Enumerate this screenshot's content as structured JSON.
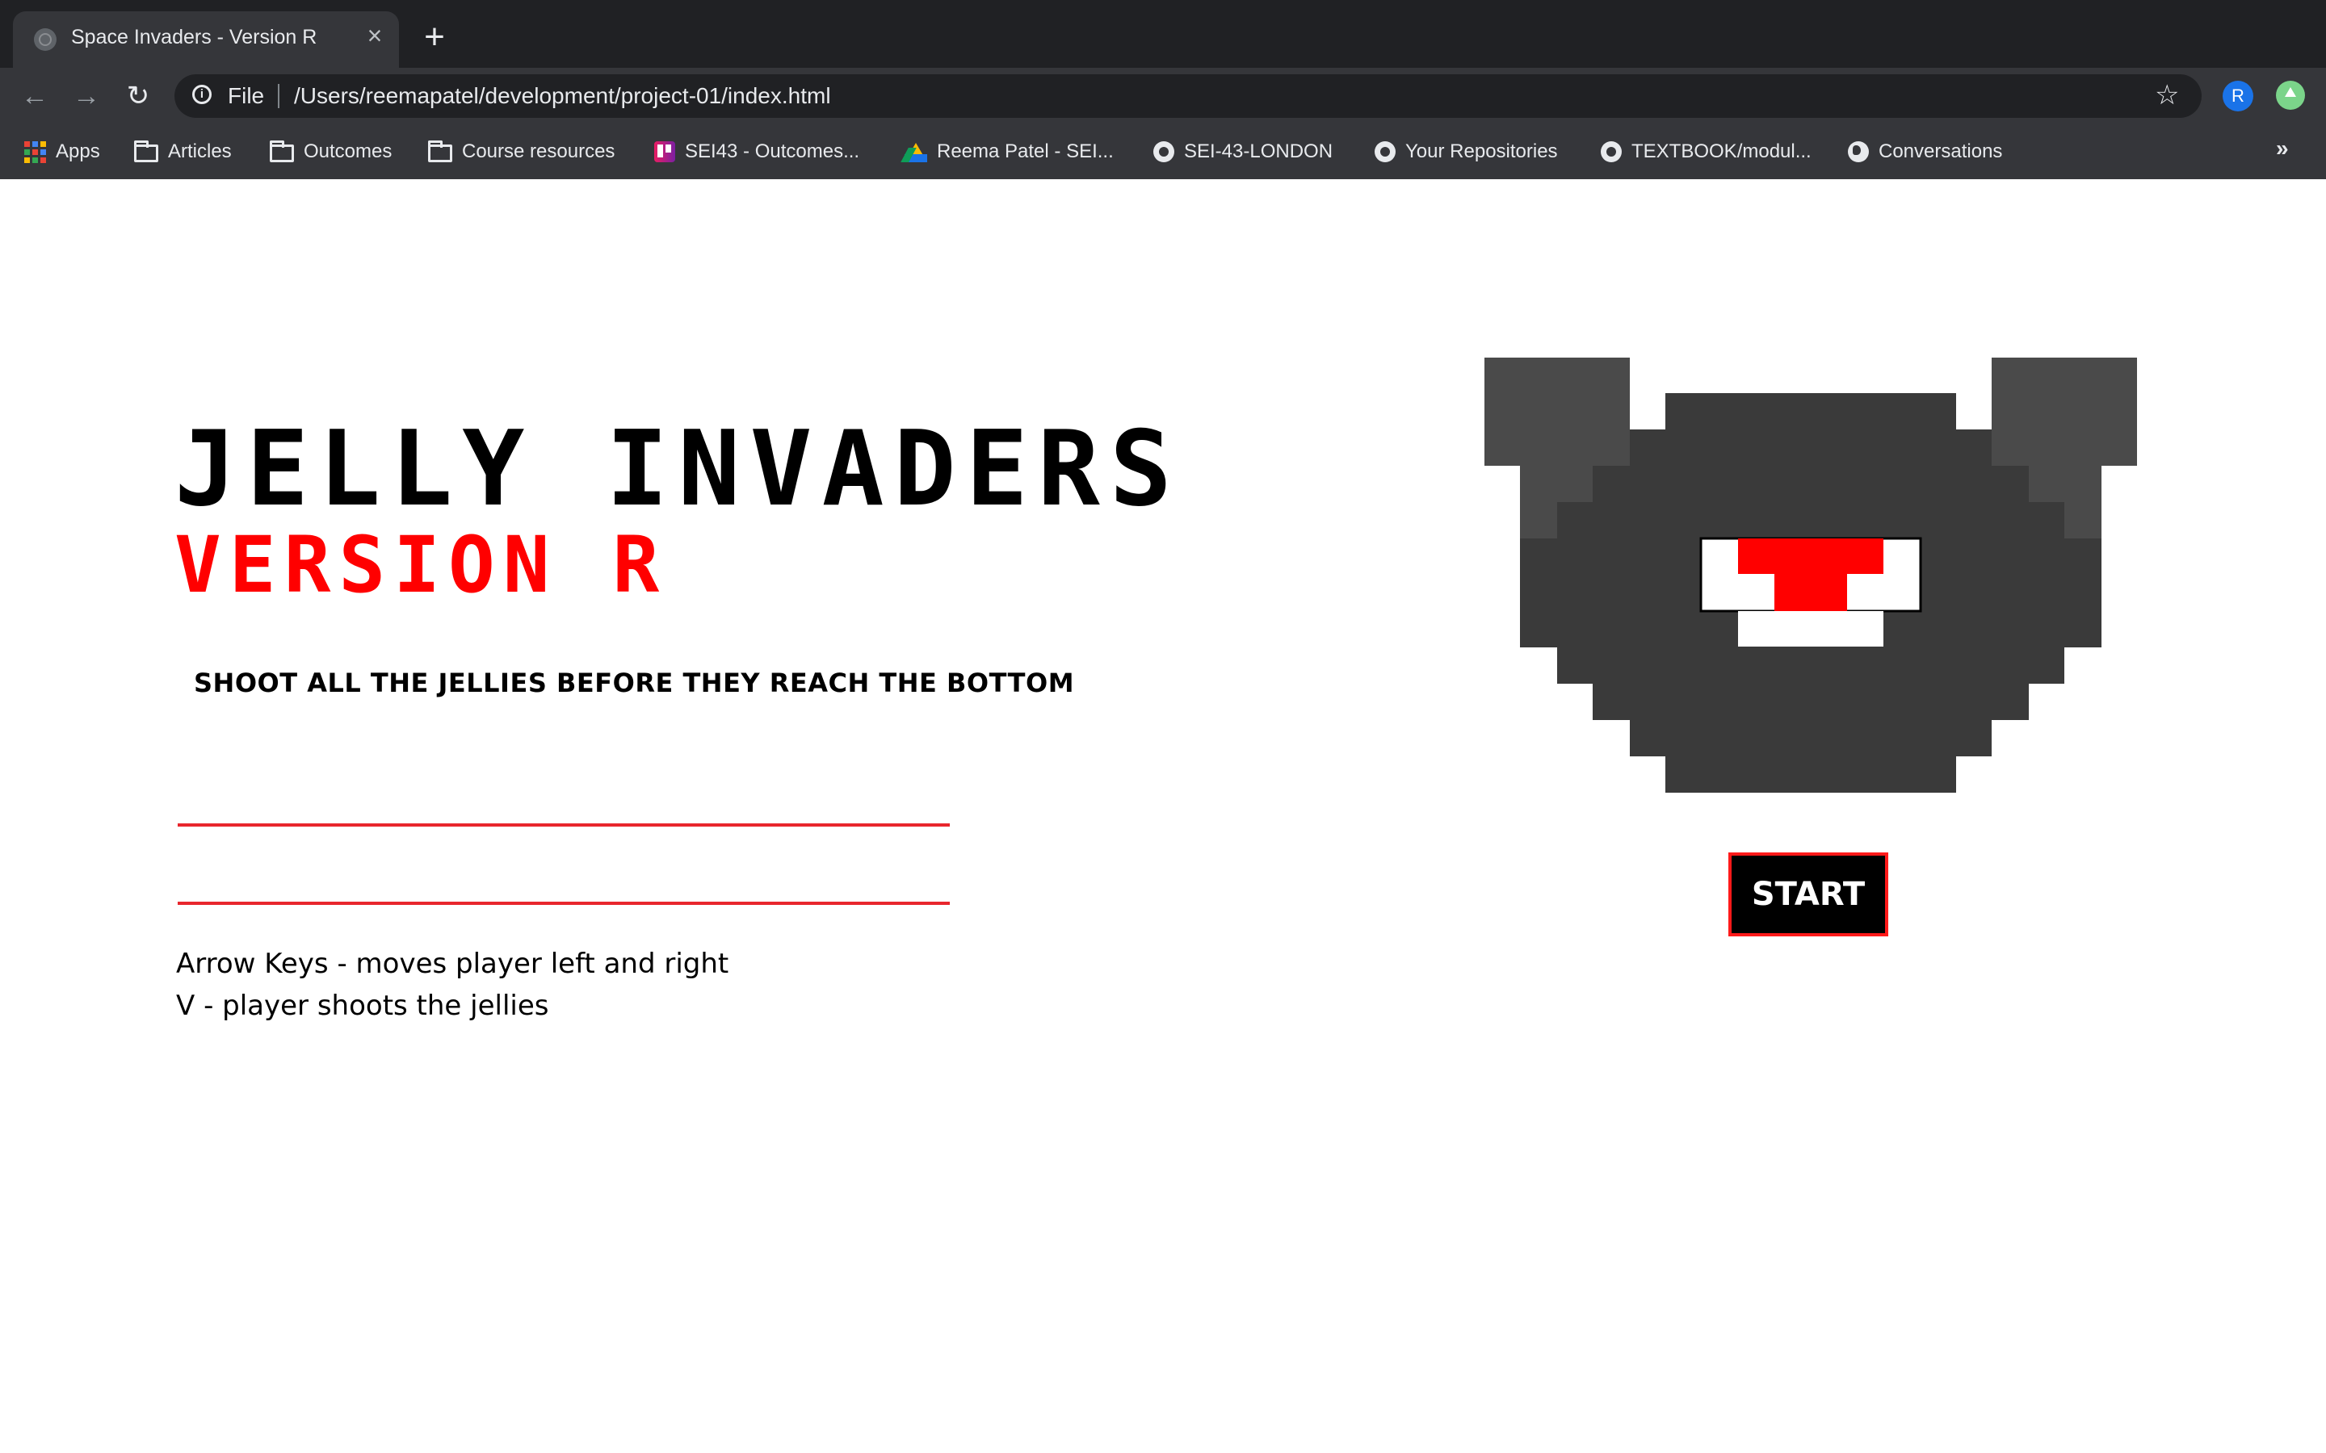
{
  "browser": {
    "tab": {
      "title": "Space Invaders - Version R",
      "close_label": "×",
      "new_tab_label": "+"
    },
    "toolbar": {
      "back_label": "←",
      "forward_label": "→",
      "reload_label": "↻",
      "scheme": "File",
      "url": "/Users/reemapatel/development/project-01/index.html",
      "star_label": "☆",
      "profile_initial": "R"
    },
    "bookmarks": [
      {
        "label": "Apps",
        "icon": "apps-icon"
      },
      {
        "label": "Articles",
        "icon": "folder-icon"
      },
      {
        "label": "Outcomes",
        "icon": "folder-icon"
      },
      {
        "label": "Course resources",
        "icon": "folder-icon"
      },
      {
        "label": "SEI43 - Outcomes...",
        "icon": "trello-icon"
      },
      {
        "label": "Reema Patel - SEI...",
        "icon": "google-drive-icon"
      },
      {
        "label": "SEI-43-LONDON",
        "icon": "github-icon"
      },
      {
        "label": "Your Repositories",
        "icon": "github-icon"
      },
      {
        "label": "TEXTBOOK/modul...",
        "icon": "github-icon"
      },
      {
        "label": "Conversations",
        "icon": "globe-icon"
      }
    ],
    "more_bookmarks_label": "»"
  },
  "game": {
    "title": "JELLY INVADERS",
    "subtitle": "VERSION R",
    "tagline": "SHOOT ALL THE JELLIES BEFORE THEY REACH THE BOTTOM",
    "instructions": [
      "Arrow Keys - moves player left and right",
      "V - player shoots the jellies"
    ],
    "start_label": "START",
    "colors": {
      "title": "#000000",
      "subtitle": "#ff0000",
      "rule": "#e8262d",
      "jelly_body": "#3a3a3a",
      "jelly_light": "#4a4a4a",
      "jelly_mouth": "#ffffff",
      "jelly_tongue": "#ff0000",
      "start_bg": "#000000",
      "start_border": "#ff1a1a"
    }
  }
}
